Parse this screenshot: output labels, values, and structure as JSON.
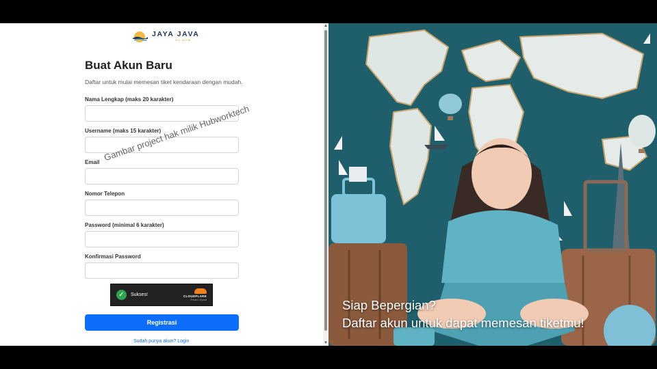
{
  "logo": {
    "title": "JAYA JAVA",
    "sub": "GO NOW"
  },
  "form": {
    "title": "Buat Akun Baru",
    "subtitle": "Daftar untuk mulai memesan tiket kendaraan dengan mudah.",
    "fields": [
      {
        "label": "Nama Lengkap (maks 20 karakter)",
        "value": ""
      },
      {
        "label": "Username (maks 15 karakter)",
        "value": ""
      },
      {
        "label": "Email",
        "value": ""
      },
      {
        "label": "Nomor Telepon",
        "value": ""
      },
      {
        "label": "Password (minimal 6 karakter)",
        "value": ""
      },
      {
        "label": "Konfirmasi Password",
        "value": ""
      }
    ],
    "submit_label": "Registrasi",
    "login_link": "Sudah punya akun? Login"
  },
  "watermark": "Gambar project hak milik Hubworktech",
  "captcha": {
    "status": "Sukses!",
    "brand": "CLOUDFLARE",
    "links": "Privasi • Syarat"
  },
  "hero": {
    "line1": "Siap Bepergian?",
    "line2": "Daftar akun untuk dapat memesan tiketmu!"
  },
  "colors": {
    "accent": "#0d6efd",
    "success": "#2ea44f",
    "hero_bg": "#1f5f6b"
  }
}
